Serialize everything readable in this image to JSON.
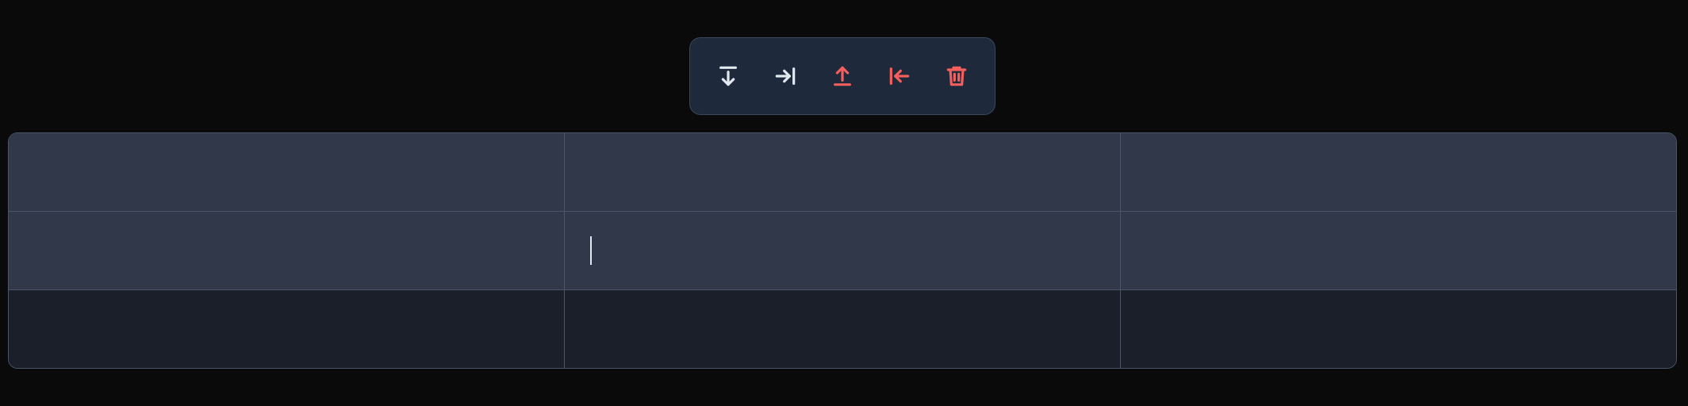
{
  "toolbar": {
    "buttons": [
      {
        "icon": "insert-row-below-icon",
        "tone": "neutral"
      },
      {
        "icon": "insert-column-right-icon",
        "tone": "neutral"
      },
      {
        "icon": "delete-row-icon",
        "tone": "danger"
      },
      {
        "icon": "delete-column-icon",
        "tone": "danger"
      },
      {
        "icon": "trash-icon",
        "tone": "danger"
      }
    ]
  },
  "table": {
    "rows": [
      [
        "",
        "",
        ""
      ],
      [
        "",
        "",
        ""
      ],
      [
        "",
        "",
        ""
      ]
    ],
    "selected_rows": [
      0,
      1
    ],
    "caret_cell": [
      1,
      1
    ]
  },
  "colors": {
    "background": "#0a0a0b",
    "toolbar_bg": "#1e293b",
    "border": "#4a5568",
    "selected_row_bg": "#303849",
    "row_bg": "#1b1f2a",
    "icon_neutral": "#e2e8f0",
    "icon_danger": "#f25f5c"
  }
}
